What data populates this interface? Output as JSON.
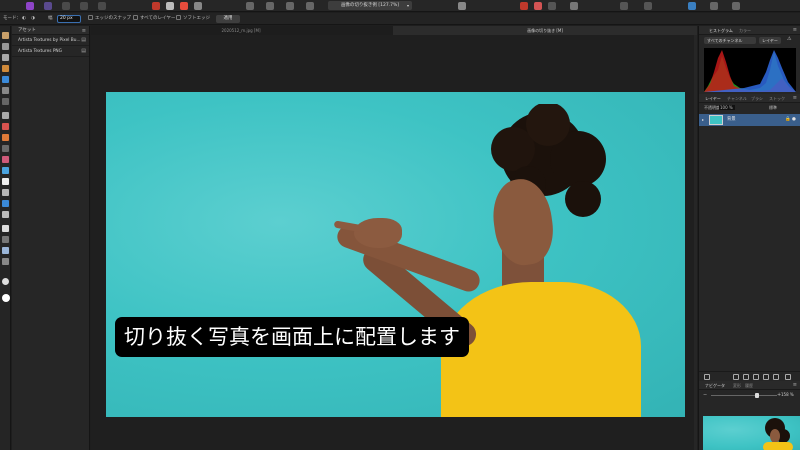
{
  "toolbar": {
    "document_title": "画像の切り抜き例 [127.7%]",
    "title_caret": "▾",
    "icons": [
      "persona-photo-icon",
      "persona-liquify-icon",
      "persona-develop-icon",
      "persona-tonemap-icon",
      "persona-export-icon",
      "undo-icon",
      "brush-icon",
      "color-icon",
      "settings-icon",
      "view-mode-icon",
      "snapping-icon",
      "assistant-icon",
      "arrange-icon",
      "studio-icon"
    ]
  },
  "context": {
    "mode_label": "モード：",
    "width_label": "幅",
    "width_value": "20 px",
    "snap_label": "エッジのスナップ",
    "all_layers_label": "すべてのレイヤー",
    "soft_edge_label": "ソフトエッジ",
    "apply_label": "適用"
  },
  "assets": {
    "title": "アセット",
    "items": [
      {
        "label": "Artista Textures by Pixel Bu..."
      },
      {
        "label": "Artista Textures PNG"
      }
    ]
  },
  "doc_tabs": [
    {
      "label": "2020512_m.jpg [M]"
    },
    {
      "label": "画像の切り抜き [M]"
    }
  ],
  "subtitle": "切り抜く写真を画面上に配置します",
  "right": {
    "hist_tabs": [
      "ヒストグラム",
      "カラー"
    ],
    "channel_select": "すべてのチャンネル",
    "layer_btn": "レイヤー",
    "layer_tabs": [
      "レイヤー",
      "チャンネル",
      "ブラシ",
      "ストック"
    ],
    "opacity_label": "不透明度",
    "opacity_value": "100 %",
    "blend_label": "標準",
    "layer_name": "背景",
    "lock_glyph": "🔒",
    "visible_glyph": "●",
    "nav_tabs": [
      "ナビゲータ",
      "変形",
      "履歴"
    ],
    "zoom_value": "158 %"
  },
  "colors": {
    "accent": "#3a5f8c",
    "background_photo": "#3ec3c4",
    "shirt": "#f3c316"
  }
}
